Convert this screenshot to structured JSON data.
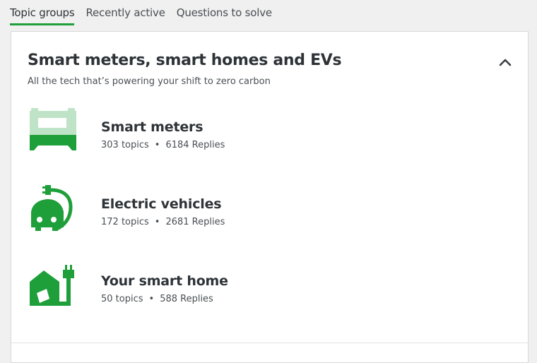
{
  "tabs": [
    {
      "label": "Topic groups",
      "active": true
    },
    {
      "label": "Recently active",
      "active": false
    },
    {
      "label": "Questions to solve",
      "active": false
    }
  ],
  "card": {
    "title": "Smart meters, smart homes and EVs",
    "subtitle": "All the tech that’s powering your shift to zero carbon",
    "collapse_icon": "chevron-up-icon"
  },
  "groups": [
    {
      "name": "Smart meters",
      "topics": "303 topics",
      "replies": "6184 Replies",
      "icon": "smart-meter-icon"
    },
    {
      "name": "Electric vehicles",
      "topics": "172 topics",
      "replies": "2681 Replies",
      "icon": "electric-car-icon"
    },
    {
      "name": "Your smart home",
      "topics": "50 topics",
      "replies": "588 Replies",
      "icon": "smart-home-icon"
    }
  ],
  "meta_separator": "•",
  "colors": {
    "accent": "#1f9f3a",
    "icon_dark": "#1f9f3a",
    "icon_light": "#bfe3c6"
  }
}
